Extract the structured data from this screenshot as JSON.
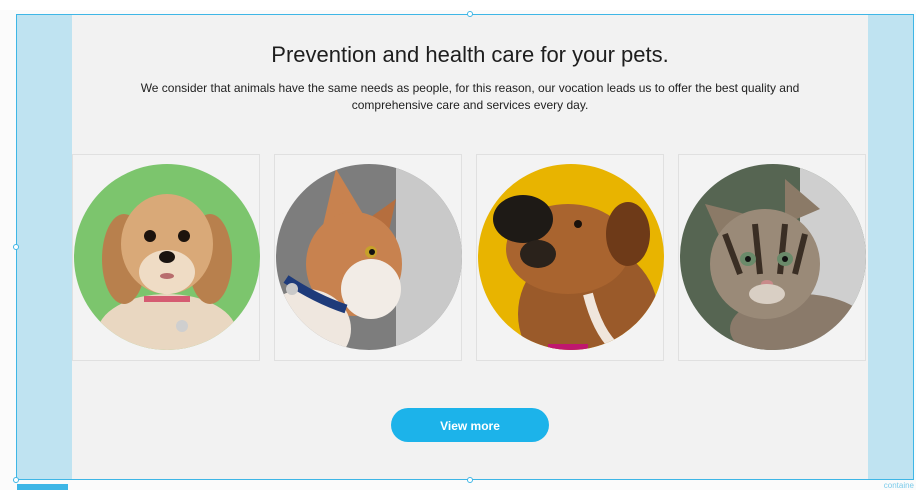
{
  "hero": {
    "title": "Prevention and health care for your pets.",
    "subtitle": "We consider that animals have the same needs as people, for this reason, our vocation leads us to offer the best quality and comprehensive care and services every day."
  },
  "pets": [
    {
      "name": "dog-photo",
      "background": "#7cc56d"
    },
    {
      "name": "cat-photo",
      "background": "#8a8a8a"
    },
    {
      "name": "boxer-dog-photo",
      "background": "#e8b400"
    },
    {
      "name": "kitten-photo",
      "background": "#5b6a52"
    }
  ],
  "cta": {
    "label": "View more"
  },
  "editor": {
    "container_label": "containe"
  },
  "colors": {
    "accent": "#1cb3ea",
    "gutter": "#bfe3f1",
    "section": "#f2f2f2"
  }
}
